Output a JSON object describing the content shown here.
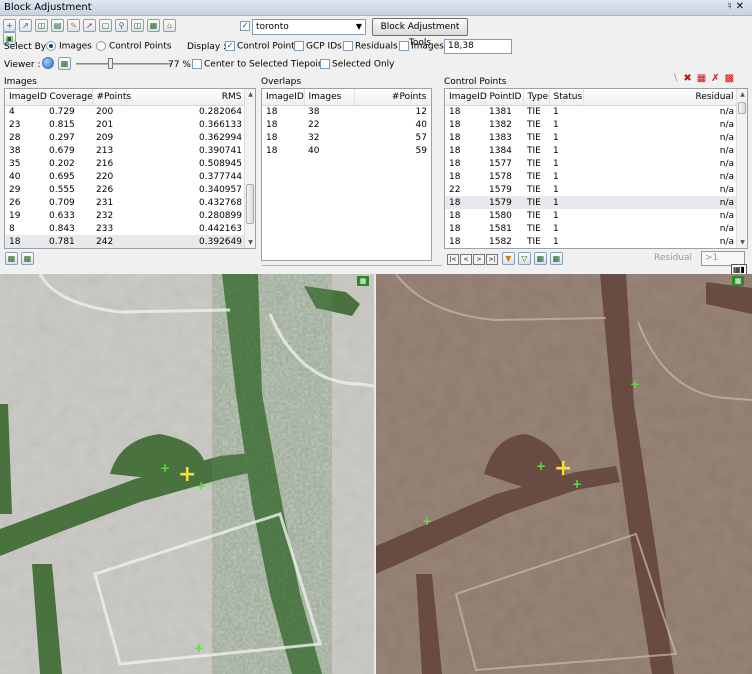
{
  "window": {
    "title": "Block Adjustment",
    "pin_icon": "pin-icon",
    "close_icon": "close-icon"
  },
  "toolbar": {
    "project_checked": true,
    "project_value": "toronto",
    "tools_button": "Block Adjustment Tools"
  },
  "select_by": {
    "label": "Select By :",
    "images": "Images",
    "control_points": "Control Points",
    "selected": "Images"
  },
  "display": {
    "label": "Display :",
    "control_points": {
      "label": "Control Points",
      "checked": true
    },
    "gcp_ids": {
      "label": "GCP IDs",
      "checked": false
    },
    "residuals": {
      "label": "Residuals",
      "checked": false
    },
    "images": {
      "label": "Images",
      "checked": false
    },
    "images_value": "18,38"
  },
  "viewer": {
    "label": "Viewer :",
    "transparency": "77 %",
    "transparency_level": 0.77,
    "center_selected": {
      "label": "Center to Selected Tiepoint",
      "checked": false
    },
    "selected_only": {
      "label": "Selected Only",
      "checked": false
    }
  },
  "images_panel": {
    "title": "Images",
    "columns": [
      "ImageID",
      "Coverage",
      "#Points",
      "RMS"
    ],
    "rows": [
      [
        "4",
        "0.729",
        "200",
        "0.282064"
      ],
      [
        "23",
        "0.815",
        "201",
        "0.366133"
      ],
      [
        "28",
        "0.297",
        "209",
        "0.362994"
      ],
      [
        "38",
        "0.679",
        "213",
        "0.390741"
      ],
      [
        "35",
        "0.202",
        "216",
        "0.508945"
      ],
      [
        "40",
        "0.695",
        "220",
        "0.377744"
      ],
      [
        "29",
        "0.555",
        "226",
        "0.340957"
      ],
      [
        "26",
        "0.709",
        "231",
        "0.432768"
      ],
      [
        "19",
        "0.633",
        "232",
        "0.280899"
      ],
      [
        "8",
        "0.843",
        "233",
        "0.442163"
      ],
      [
        "18",
        "0.781",
        "242",
        "0.392649"
      ]
    ],
    "selected_row": 10
  },
  "overlaps_panel": {
    "title": "Overlaps",
    "columns": [
      "ImageID",
      "Images",
      "#Points"
    ],
    "rows": [
      [
        "18",
        "38",
        "12"
      ],
      [
        "18",
        "22",
        "40"
      ],
      [
        "18",
        "32",
        "57"
      ],
      [
        "18",
        "40",
        "59"
      ]
    ]
  },
  "control_points_panel": {
    "title": "Control Points",
    "columns": [
      "ImageID",
      "PointID",
      "Type",
      "Status",
      "Residual"
    ],
    "rows": [
      [
        "18",
        "1381",
        "TIE",
        "1",
        "n/a"
      ],
      [
        "18",
        "1382",
        "TIE",
        "1",
        "n/a"
      ],
      [
        "18",
        "1383",
        "TIE",
        "1",
        "n/a"
      ],
      [
        "18",
        "1384",
        "TIE",
        "1",
        "n/a"
      ],
      [
        "18",
        "1577",
        "TIE",
        "1",
        "n/a"
      ],
      [
        "18",
        "1578",
        "TIE",
        "1",
        "n/a"
      ],
      [
        "22",
        "1579",
        "TIE",
        "1",
        "n/a"
      ],
      [
        "18",
        "1579",
        "TIE",
        "1",
        "n/a"
      ],
      [
        "18",
        "1580",
        "TIE",
        "1",
        "n/a"
      ],
      [
        "18",
        "1581",
        "TIE",
        "1",
        "n/a"
      ],
      [
        "18",
        "1582",
        "TIE",
        "1",
        "n/a"
      ]
    ],
    "selected_row": 7,
    "residual_label": "Residual",
    "residual_filter": ">1"
  },
  "colors": {
    "selection": "#e7e9ec",
    "crosshair": "#57e03a",
    "tiepoint": "#f2e23a"
  }
}
